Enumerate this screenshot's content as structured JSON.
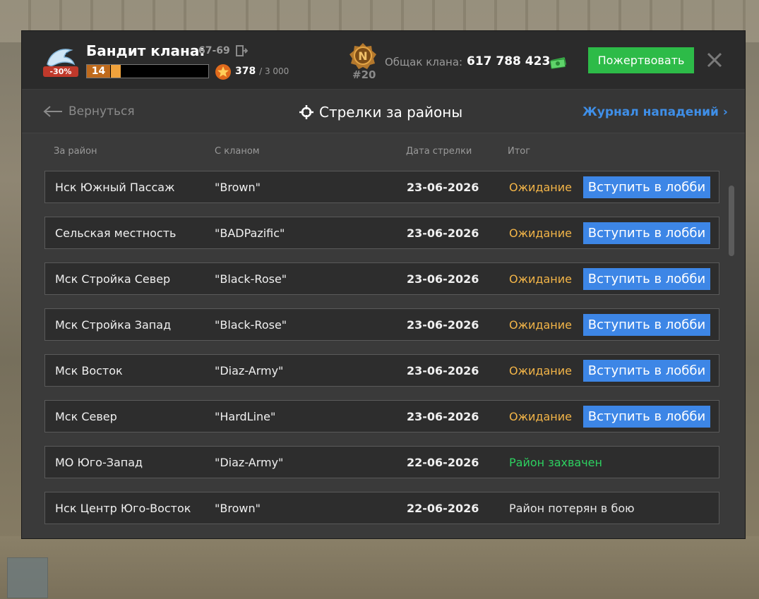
{
  "header": {
    "rank_title": "Бандит клана:",
    "rank_range": "67-69",
    "discount": "-30%",
    "level": "14",
    "level_progress": 0.1,
    "xp_current": "378",
    "xp_max": "/ 3 000",
    "league_letter": "N",
    "league_rank": "#20",
    "fund_label": "Общак клана:",
    "fund_value": "617 788 423",
    "donate_label": "Пожертвовать"
  },
  "nav": {
    "back_label": "Вернуться",
    "title": "Стрелки за районы",
    "log_label": "Журнал нападений ›"
  },
  "columns": {
    "district": "За район",
    "clan": "С кланом",
    "date": "Дата стрелки",
    "result": "Итог"
  },
  "rows": [
    {
      "district": "Нск Южный Пассаж",
      "clan": "\"Brown\"",
      "date": "23-06-2026",
      "result": "Ожидание",
      "button": "Вступить в лобби"
    },
    {
      "district": "Сельская местность",
      "clan": "\"BADPazific\"",
      "date": "23-06-2026",
      "result": "Ожидание",
      "button": "Вступить в лобби"
    },
    {
      "district": "Мск Стройка Север",
      "clan": "\"Black-Rose\"",
      "date": "23-06-2026",
      "result": "Ожидание",
      "button": "Вступить в лобби"
    },
    {
      "district": "Мск Стройка Запад",
      "clan": "\"Black-Rose\"",
      "date": "23-06-2026",
      "result": "Ожидание",
      "button": "Вступить в лобби"
    },
    {
      "district": "Мск Восток",
      "clan": "\"Diaz-Army\"",
      "date": "23-06-2026",
      "result": "Ожидание",
      "button": "Вступить в лобби"
    },
    {
      "district": "Мск Север",
      "clan": "\"HardLine\"",
      "date": "23-06-2026",
      "result": "Ожидание",
      "button": "Вступить в лобби"
    },
    {
      "district": "МО Юго-Запад",
      "clan": "\"Diaz-Army\"",
      "date": "22-06-2026",
      "result": "Район захвачен",
      "button": ""
    },
    {
      "district": "Нск Центр Юго-Восток",
      "clan": "\"Brown\"",
      "date": "22-06-2026",
      "result": "Район потерян в бою",
      "button": ""
    }
  ],
  "colors": {
    "waiting": "#f3b548",
    "captured": "#2dd160",
    "lost": "#e6e6e6",
    "join_button": "#3d86e6",
    "donate_button": "#2dbb48"
  },
  "icons": {
    "clan_logo": "dolphin-icon",
    "exit": "exit-door-icon",
    "xp": "star-icon",
    "league": "league-badge-icon",
    "money": "money-icon",
    "close": "close-icon",
    "back": "arrow-left-icon",
    "title": "crosshair-icon"
  }
}
